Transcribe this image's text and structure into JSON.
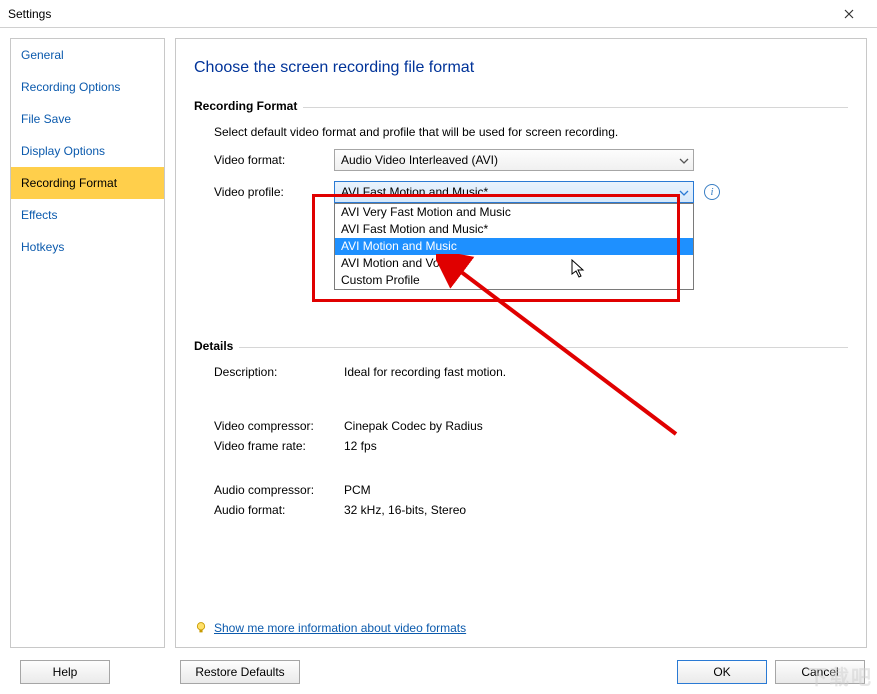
{
  "window": {
    "title": "Settings"
  },
  "sidebar": {
    "items": [
      {
        "label": "General"
      },
      {
        "label": "Recording Options"
      },
      {
        "label": "File Save"
      },
      {
        "label": "Display Options"
      },
      {
        "label": "Recording Format"
      },
      {
        "label": "Effects"
      },
      {
        "label": "Hotkeys"
      }
    ],
    "active_index": 4
  },
  "content": {
    "heading": "Choose the screen recording file format",
    "group_recording": {
      "legend": "Recording Format",
      "description": "Select default video format and profile that will be used for screen recording.",
      "video_format_label": "Video format:",
      "video_format_value": "Audio Video Interleaved (AVI)",
      "video_profile_label": "Video profile:",
      "video_profile_value": "AVI Fast Motion and Music*",
      "profile_options": [
        "AVI Very Fast Motion and Music",
        "AVI Fast Motion and Music*",
        "AVI Motion and Music",
        "AVI Motion and Voice",
        "Custom Profile"
      ],
      "profile_highlight_index": 2
    },
    "group_details": {
      "legend": "Details",
      "rows": {
        "description_label": "Description:",
        "description_value": "Ideal for recording fast motion.",
        "video_compressor_label": "Video compressor:",
        "video_compressor_value": "Cinepak Codec by Radius",
        "video_frame_rate_label": "Video frame rate:",
        "video_frame_rate_value": "12 fps",
        "audio_compressor_label": "Audio compressor:",
        "audio_compressor_value": "PCM",
        "audio_format_label": "Audio format:",
        "audio_format_value": "32 kHz, 16-bits, Stereo"
      }
    },
    "more_link": "Show me more information about video formats"
  },
  "footer": {
    "help": "Help",
    "restore": "Restore Defaults",
    "ok": "OK",
    "cancel": "Cancel"
  },
  "watermark": "下载吧"
}
